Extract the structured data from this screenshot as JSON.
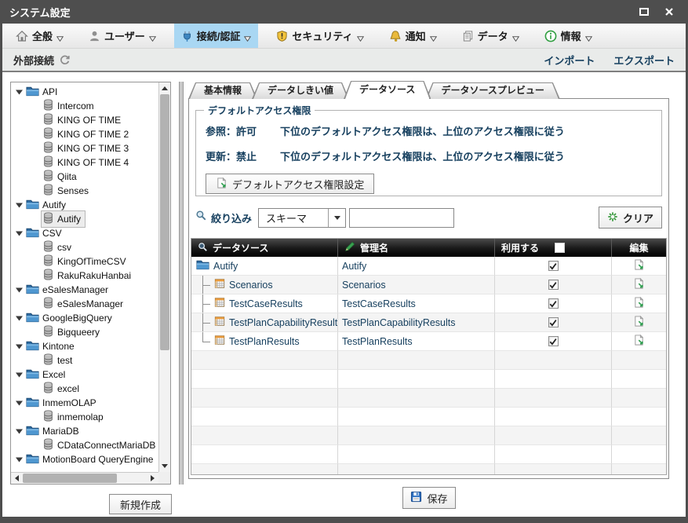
{
  "window": {
    "title": "システム設定"
  },
  "menubar": {
    "items": [
      {
        "label": "全般",
        "icon": "home-icon",
        "active": false
      },
      {
        "label": "ユーザー",
        "icon": "user-icon",
        "active": false
      },
      {
        "label": "接続/認証",
        "icon": "plug-icon",
        "active": true
      },
      {
        "label": "セキュリティ",
        "icon": "shield-icon",
        "active": false
      },
      {
        "label": "通知",
        "icon": "bell-icon",
        "active": false
      },
      {
        "label": "データ",
        "icon": "data-icon",
        "active": false
      },
      {
        "label": "情報",
        "icon": "info-icon",
        "active": false
      }
    ]
  },
  "toolbar": {
    "section_label": "外部接続",
    "import_label": "インポート",
    "export_label": "エクスポート"
  },
  "tree": {
    "groups": [
      {
        "label": "API",
        "children": [
          {
            "label": "Intercom"
          },
          {
            "label": "KING OF TIME"
          },
          {
            "label": "KING OF TIME 2"
          },
          {
            "label": "KING OF TIME 3"
          },
          {
            "label": "KING OF TIME 4"
          },
          {
            "label": "Qiita"
          },
          {
            "label": "Senses"
          }
        ]
      },
      {
        "label": "Autify",
        "children": [
          {
            "label": "Autify",
            "selected": true
          }
        ]
      },
      {
        "label": "CSV",
        "children": [
          {
            "label": "csv"
          },
          {
            "label": "KingOfTimeCSV"
          },
          {
            "label": "RakuRakuHanbai"
          }
        ]
      },
      {
        "label": "eSalesManager",
        "children": [
          {
            "label": "eSalesManager"
          }
        ]
      },
      {
        "label": "GoogleBigQuery",
        "children": [
          {
            "label": "Bigqueery"
          }
        ]
      },
      {
        "label": "Kintone",
        "children": [
          {
            "label": "test"
          }
        ]
      },
      {
        "label": "Excel",
        "children": [
          {
            "label": "excel"
          }
        ]
      },
      {
        "label": "InmemOLAP",
        "children": [
          {
            "label": "inmemolap"
          }
        ]
      },
      {
        "label": "MariaDB",
        "children": [
          {
            "label": "CDataConnectMariaDB"
          }
        ]
      },
      {
        "label": "MotionBoard QueryEngine",
        "children": []
      }
    ]
  },
  "new_button_label": "新規作成",
  "tabs": {
    "active_index": 2,
    "items": [
      "基本情報",
      "データしきい値",
      "データソース",
      "データソースプレビュー"
    ]
  },
  "access_panel": {
    "legend": "デフォルトアクセス権限",
    "rows": [
      {
        "status": "参照：許可",
        "note": "下位のデフォルトアクセス権限は、上位のアクセス権限に従う"
      },
      {
        "status": "更新：禁止",
        "note": "下位のデフォルトアクセス権限は、上位のアクセス権限に従う"
      }
    ],
    "button_label": "デフォルトアクセス権限設定"
  },
  "filter": {
    "label": "絞り込み",
    "dropdown_value": "スキーマ",
    "input_value": "",
    "clear_label": "クリア"
  },
  "datasource_table": {
    "headers": [
      {
        "label": "データソース",
        "icon": "search-icon"
      },
      {
        "label": "管理名",
        "icon": "pencil-icon"
      },
      {
        "label": "利用する",
        "checkbox": true,
        "checkbox_checked": false
      },
      {
        "label": "編集"
      }
    ],
    "rows": [
      {
        "name": "Autify",
        "admin_name": "Autify",
        "type": "folder",
        "checked": true
      },
      {
        "name": "Scenarios",
        "admin_name": "Scenarios",
        "type": "table",
        "checked": true
      },
      {
        "name": "TestCaseResults",
        "admin_name": "TestCaseResults",
        "type": "table",
        "checked": true
      },
      {
        "name": "TestPlanCapabilityResults",
        "admin_name": "TestPlanCapabilityResults",
        "type": "table",
        "checked": true
      },
      {
        "name": "TestPlanResults",
        "admin_name": "TestPlanResults",
        "type": "table",
        "checked": true,
        "last_child": true
      }
    ],
    "empty_rows": 7
  },
  "save_button_label": "保存",
  "colors": {
    "menu_highlight": "#a9d7f3",
    "navy_text": "#17405f",
    "titlebar_bg": "#4e4e4e",
    "table_header_bg": "#1a1a1a",
    "green_accent": "#2e9e4f",
    "gold_accent": "#e8b83a",
    "folder_blue": "#3f86c2"
  }
}
